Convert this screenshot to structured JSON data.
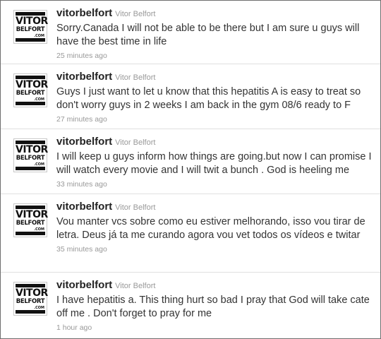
{
  "tweets": [
    {
      "screen_name": "vitorbelfort",
      "full_name": "Vitor Belfort",
      "text": "Sorry.Canada I will not be able to be there but I am sure u guys will have the best time in life",
      "time": "25 minutes ago",
      "avatar": {
        "main": "VITOR",
        "sub": "BELFORT",
        "com": ".COM"
      }
    },
    {
      "screen_name": "vitorbelfort",
      "full_name": "Vitor Belfort",
      "text": "Guys I just want to let u know that this hepatitis A is easy to treat so don't worry guys in 2 weeks I am back in the gym 08/6 ready to F",
      "time": "27 minutes ago",
      "avatar": {
        "main": "VITOR",
        "sub": "BELFORT",
        "com": ".COM"
      }
    },
    {
      "screen_name": "vitorbelfort",
      "full_name": "Vitor Belfort",
      "text": "I will keep u guys inform how things are going.but now I can promise I will watch every movie and I will twit a bunch . God is heeling me",
      "time": "33 minutes ago",
      "avatar": {
        "main": "VITOR",
        "sub": "BELFORT",
        "com": ".COM"
      }
    },
    {
      "screen_name": "vitorbelfort",
      "full_name": "Vitor Belfort",
      "text": "Vou manter vcs sobre como eu estiver melhorando, isso vou tirar de letra. Deus já ta me curando agora vou vet todos os vídeos e twitar",
      "time": "35 minutes ago",
      "avatar": {
        "main": "VITOR",
        "sub": "BELFORT",
        "com": ".COM"
      }
    },
    {
      "screen_name": "vitorbelfort",
      "full_name": "Vitor Belfort",
      "text": "I have hepatitis a. This thing hurt so bad I pray that God will take cate off me . Don't forget to pray for me",
      "time": "1 hour ago",
      "avatar": {
        "main": "VITOR",
        "sub": "BELFORT",
        "com": ".COM"
      }
    }
  ]
}
